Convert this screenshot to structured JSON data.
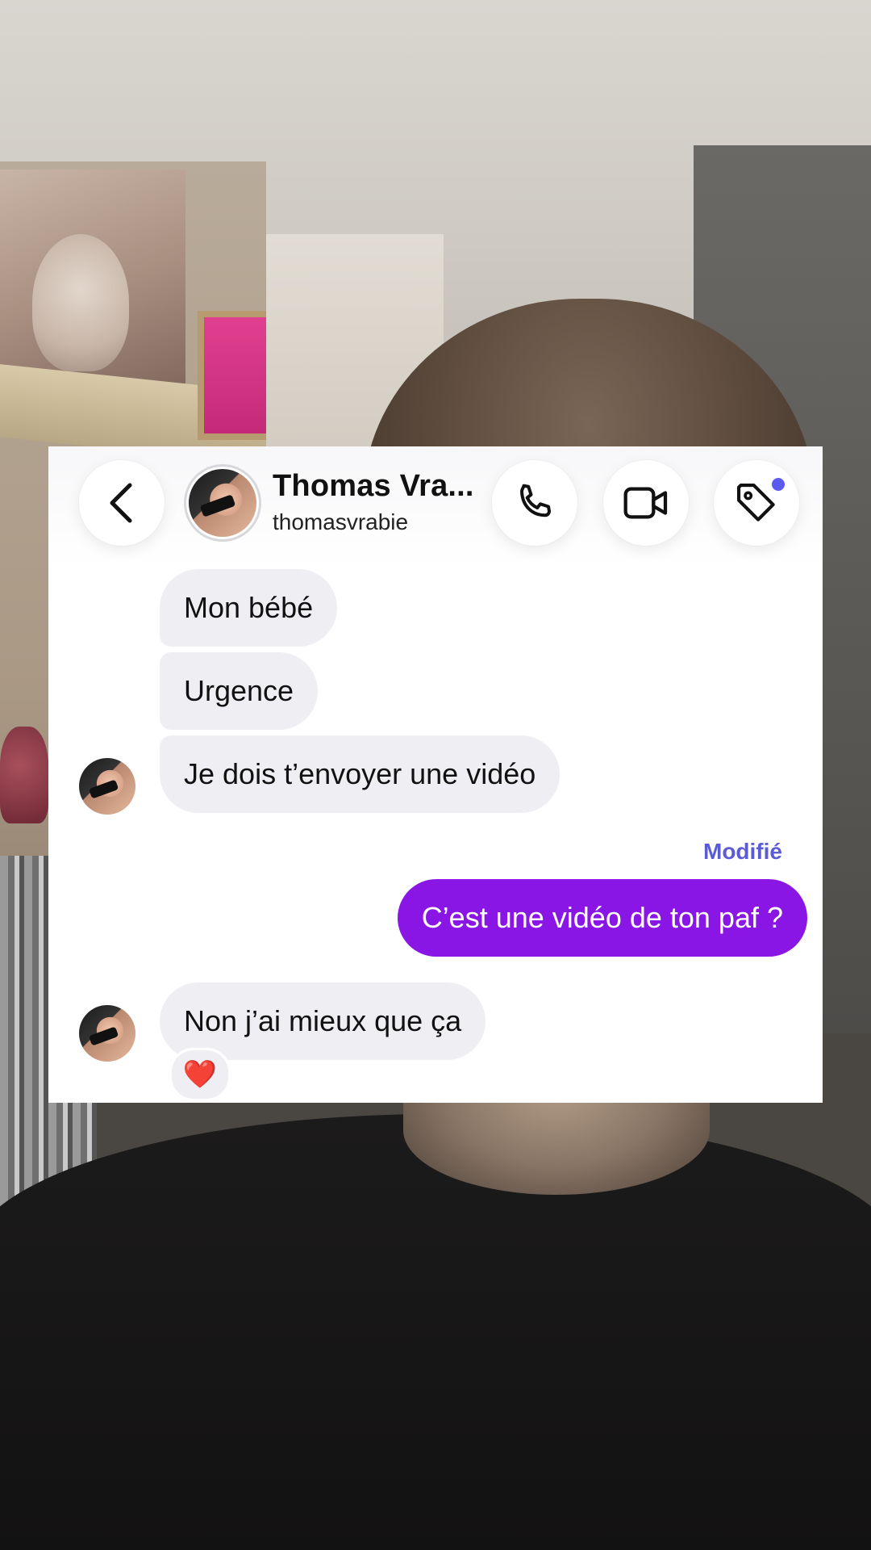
{
  "header": {
    "name": "Thomas Vra...",
    "username": "thomasvrabie"
  },
  "icons": {
    "back": "chevron-left-icon",
    "call": "phone-icon",
    "video": "video-camera-icon",
    "tag": "tag-icon"
  },
  "messages": [
    {
      "direction": "received",
      "text": "Mon bébé"
    },
    {
      "direction": "received",
      "text": "Urgence"
    },
    {
      "direction": "received",
      "text": "Je dois t’envoyer une vidéo"
    },
    {
      "direction": "sent",
      "status": "Modifié",
      "text": "C’est une vidéo de ton paf ?"
    },
    {
      "direction": "received",
      "text": "Non j’ai mieux que ça",
      "reaction": "❤️"
    }
  ],
  "colors": {
    "sent_bubble": "#8a16e6",
    "received_bubble": "#efeff3",
    "edited_label": "#5b5bd6",
    "notification_dot": "#5b5bf0",
    "heart": "#e0102a"
  }
}
